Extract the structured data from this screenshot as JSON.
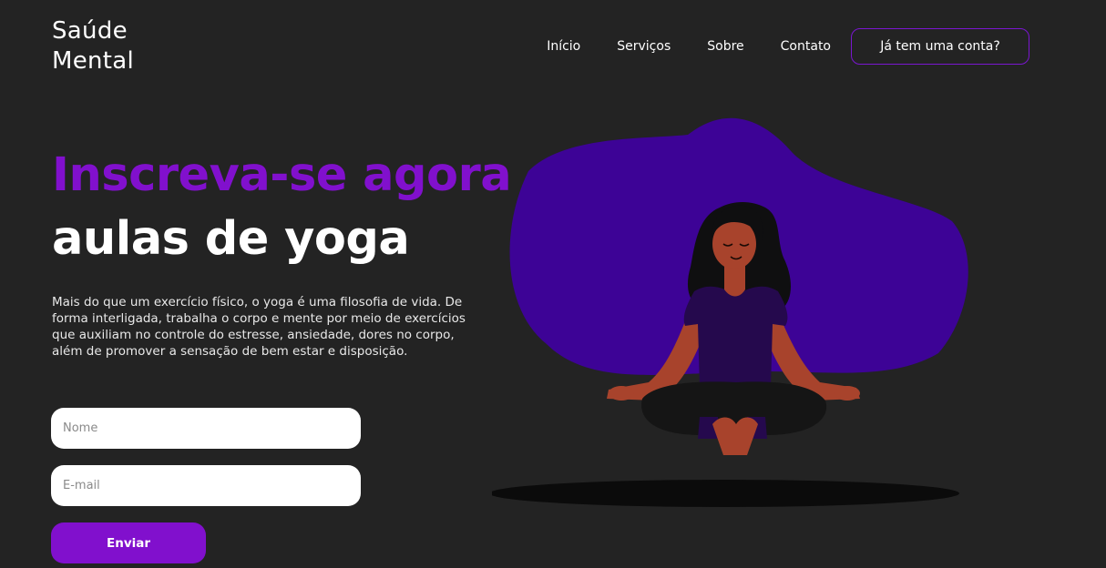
{
  "brand": {
    "line1": "Saúde",
    "line2": "Mental"
  },
  "nav": {
    "items": [
      {
        "label": "Início"
      },
      {
        "label": "Serviços"
      },
      {
        "label": "Sobre"
      },
      {
        "label": "Contato"
      }
    ],
    "account_label": "Já tem uma conta?"
  },
  "hero": {
    "headline": "Inscreva-se agora",
    "subheadline": "aulas de yoga",
    "description": "Mais do que um exercício físico, o yoga é uma filosofia de vida. De forma interligada, trabalha o corpo e mente por meio de exercícios que auxiliam no controle do estresse, ansiedade, dores no corpo, além de promover a sensação de bem estar e disposição."
  },
  "form": {
    "name_placeholder": "Nome",
    "email_placeholder": "E-mail",
    "submit_label": "Enviar"
  },
  "colors": {
    "background": "#232323",
    "accent": "#8110cd",
    "blob": "#3d0396",
    "shadow": "#0b0b0b"
  },
  "illustration": {
    "icon": "meditating-woman-icon"
  }
}
